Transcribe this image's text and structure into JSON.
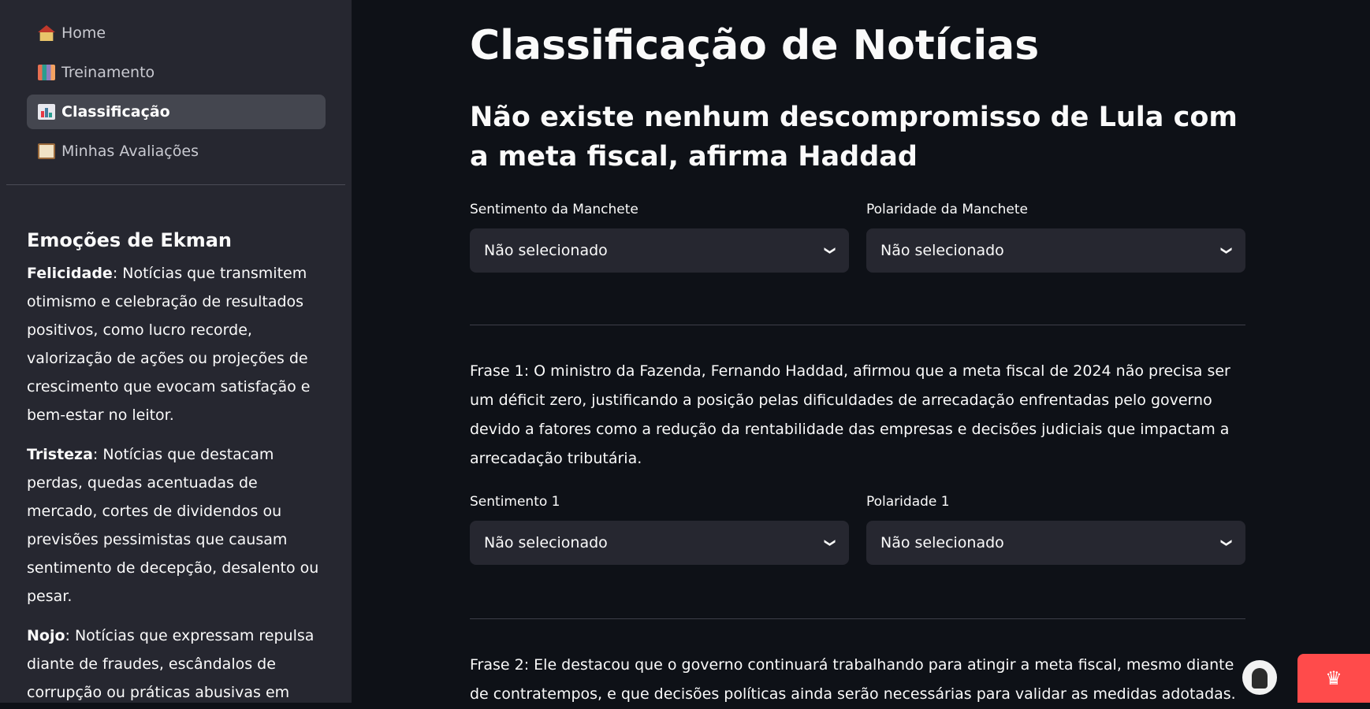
{
  "sidebar": {
    "nav": [
      {
        "label": "Home",
        "icon": "house-icon"
      },
      {
        "label": "Treinamento",
        "icon": "books-icon"
      },
      {
        "label": "Classificação",
        "icon": "bar-chart-icon"
      },
      {
        "label": "Minhas Avaliações",
        "icon": "clipboard-icon"
      }
    ],
    "active_index": 2,
    "section_title": "Emoções de Ekman",
    "emotions": [
      {
        "term": "Felicidade",
        "text": ": Notícias que transmitem otimismo e celebração de resultados positivos, como lucro recorde, valorização de ações ou projeções de crescimento que evocam satisfação e bem-estar no leitor."
      },
      {
        "term": "Tristeza",
        "text": ": Notícias que destacam perdas, quedas acentuadas de mercado, cortes de dividendos ou previsões pessimistas que causam sentimento de decepção, desalento ou pesar."
      },
      {
        "term": "Nojo",
        "text": ": Notícias que expressam repulsa diante de fraudes, escândalos de corrupção ou práticas abusivas em"
      }
    ]
  },
  "main": {
    "title": "Classificação de Notícias",
    "headline": "Não existe nenhum descompromisso de Lula com a meta fiscal, afirma Haddad",
    "headline_fields": {
      "sentiment_label": "Sentimento da Manchete",
      "sentiment_value": "Não selecionado",
      "polarity_label": "Polaridade da Manchete",
      "polarity_value": "Não selecionado"
    },
    "sentences": [
      {
        "text": "Frase 1: O ministro da Fazenda, Fernando Haddad, afirmou que a meta fiscal de 2024 não precisa ser um déficit zero, justificando a posição pelas dificuldades de arrecadação enfrentadas pelo governo devido a fatores como a redução da rentabilidade das empresas e decisões judiciais que impactam a arrecadação tributária.",
        "sentiment_label": "Sentimento 1",
        "sentiment_value": "Não selecionado",
        "polarity_label": "Polaridade 1",
        "polarity_value": "Não selecionado"
      },
      {
        "text": "Frase 2: Ele destacou que o governo continuará trabalhando para atingir a meta fiscal, mesmo diante de contratempos, e que decisões políticas ainda serão necessárias para validar as medidas adotadas."
      }
    ]
  },
  "colors": {
    "background": "#0e1117",
    "sidebar": "#262730",
    "select_bg": "#262730",
    "active_nav": "#44464f",
    "deploy_button": "#ff4b4b"
  }
}
